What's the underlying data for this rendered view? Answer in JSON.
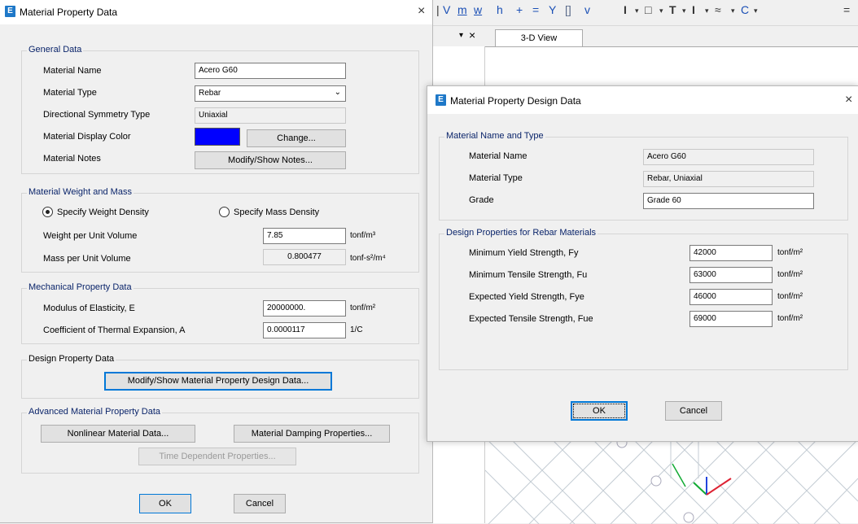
{
  "background": {
    "toolbar_icons": [
      "|",
      "V",
      "m",
      "w",
      "h",
      "+",
      "=",
      "Y",
      "[]",
      "v"
    ],
    "toolbar_right": [
      "I",
      "▾",
      "□",
      "▾",
      "T",
      "▾",
      "I",
      "▾",
      "≈",
      "▾",
      "C",
      "▾",
      "="
    ],
    "pane_controls": {
      "pin": "▾",
      "close": "×"
    },
    "tab_label": "3-D View"
  },
  "mpd": {
    "title": "Material Property Data",
    "close": "×",
    "general": {
      "title": "General Data",
      "material_name_label": "Material Name",
      "material_name_value": "Acero G60",
      "material_type_label": "Material Type",
      "material_type_value": "Rebar",
      "dir_sym_label": "Directional Symmetry Type",
      "dir_sym_value": "Uniaxial",
      "display_color_label": "Material Display Color",
      "display_color": "#0000ff",
      "change_button": "Change...",
      "notes_label": "Material Notes",
      "notes_button": "Modify/Show Notes..."
    },
    "weight": {
      "title": "Material Weight and Mass",
      "radio_weight": "Specify Weight Density",
      "radio_mass": "Specify Mass Density",
      "weight_label": "Weight per Unit Volume",
      "weight_value": "7.85",
      "weight_unit": "tonf/m³",
      "mass_label": "Mass per Unit Volume",
      "mass_value": "0.800477",
      "mass_unit": "tonf-s²/m⁴"
    },
    "mech": {
      "title": "Mechanical Property Data",
      "modulus_label": "Modulus of Elasticity,  E",
      "modulus_value": "20000000.",
      "modulus_unit": "tonf/m²",
      "thermal_label": "Coefficient of Thermal Expansion,  A",
      "thermal_value": "0.0000117",
      "thermal_unit": "1/C"
    },
    "design": {
      "title": "Design Property Data",
      "button": "Modify/Show Material Property Design Data..."
    },
    "advanced": {
      "title": "Advanced Material Property Data",
      "nonlinear": "Nonlinear Material Data...",
      "damping": "Material Damping Properties...",
      "time": "Time Dependent Properties..."
    },
    "ok": "OK",
    "cancel": "Cancel"
  },
  "mpdd": {
    "title": "Material Property Design Data",
    "close": "×",
    "name_type": {
      "title": "Material Name and Type",
      "name_label": "Material Name",
      "name_value": "Acero G60",
      "type_label": "Material Type",
      "type_value": "Rebar, Uniaxial",
      "grade_label": "Grade",
      "grade_value": "Grade 60"
    },
    "rebar": {
      "title": "Design Properties for Rebar Materials",
      "rows": [
        {
          "label": "Minimum Yield Strength, Fy",
          "value": "42000",
          "unit": "tonf/m²"
        },
        {
          "label": "Minimum Tensile Strength, Fu",
          "value": "63000",
          "unit": "tonf/m²"
        },
        {
          "label": "Expected Yield Strength, Fye",
          "value": "46000",
          "unit": "tonf/m²"
        },
        {
          "label": "Expected Tensile Strength, Fue",
          "value": "69000",
          "unit": "tonf/m²"
        }
      ]
    },
    "ok": "OK",
    "cancel": "Cancel"
  }
}
